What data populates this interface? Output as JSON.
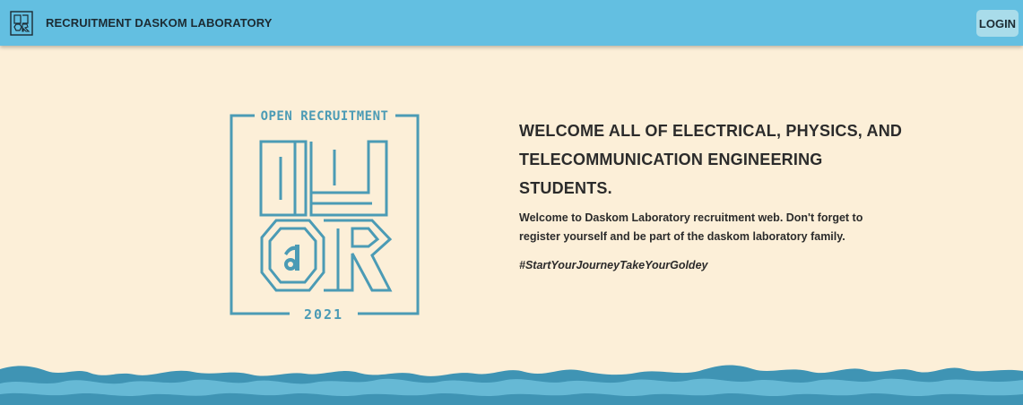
{
  "navbar": {
    "title": "RECRUITMENT DASKOM LABORATORY",
    "login_label": "LOGIN",
    "logo_icon": "daskom-logo-icon",
    "background_color": "#63bfe1"
  },
  "hero": {
    "logo_top_text": "OPEN RECRUITMENT",
    "logo_year": "2021",
    "logo_color": "#4b9bb5",
    "headline": "WELCOME ALL OF ELECTRICAL, PHYSICS, AND TELECOMMUNICATION ENGINEERING STUDENTS.",
    "description": "Welcome to Daskom Laboratory recruitment web. Don't forget to register yourself and be part of the daskom laboratory family.",
    "hashtag": "#StartYourJourneyTakeYourGoldey"
  },
  "colors": {
    "page_background": "#fcefd8",
    "wave_dark": "#3f94b4",
    "wave_light": "#66b9d5"
  }
}
